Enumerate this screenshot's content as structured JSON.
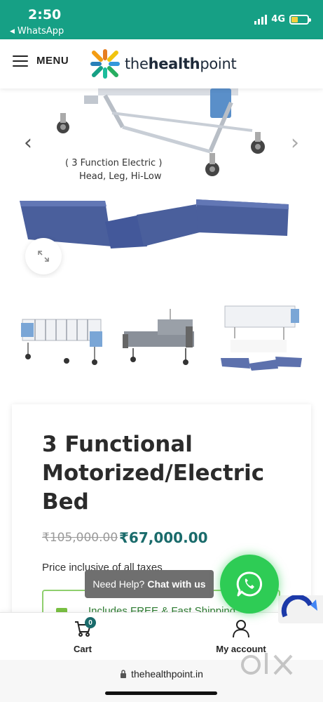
{
  "status_bar": {
    "time": "2:50",
    "back_app": "WhatsApp",
    "network": "4G",
    "bg_color": "#16a085"
  },
  "header": {
    "menu_label": "MENU",
    "logo": {
      "prefix": "the",
      "bold": "health",
      "suffix": "point"
    }
  },
  "gallery": {
    "caption_line1": "( 3 Function Electric )",
    "caption_line2": "Head, Leg, Hi-Low",
    "prev_icon": "chevron-left-icon",
    "next_icon": "chevron-right-icon",
    "zoom_icon": "expand-icon"
  },
  "thumbnails": [
    {
      "name": "bed-white-rails"
    },
    {
      "name": "bed-grey"
    },
    {
      "name": "bed-with-mattress"
    }
  ],
  "product": {
    "title": "3 Functional Motorized/Electric Bed",
    "old_price": "₹105,000.00",
    "new_price": "₹67,000.00",
    "tax_note": "Price inclusive of all taxes",
    "promo_text": "Includes FREE & Fast Shipping",
    "price_color": "#1a6b6b"
  },
  "chat": {
    "need_help": "Need Help?",
    "chat_with_us": "Chat with us"
  },
  "bottom_nav": {
    "cart_label": "Cart",
    "cart_count": "0",
    "account_label": "My account"
  },
  "browser": {
    "url": "thehealthpoint.in"
  }
}
